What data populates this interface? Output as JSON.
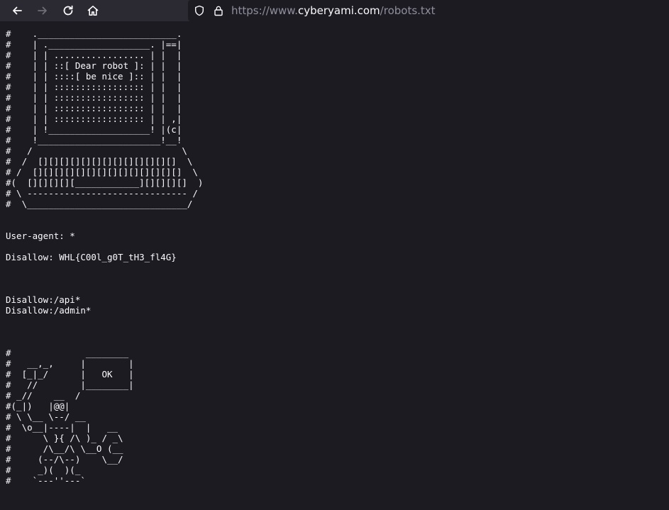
{
  "browser": {
    "url_scheme": "https://www.",
    "url_host": "cyberyami.com",
    "url_path": "/robots.txt",
    "icons": [
      "back-arrow-icon",
      "forward-arrow-icon",
      "reload-icon",
      "home-icon",
      "shield-icon",
      "lock-icon"
    ],
    "colors": {
      "toolbar": "#2b2a33",
      "page": "#1c1b22",
      "text": "#fbfbfe",
      "url_dim": "#8f8f9d"
    }
  },
  "robots_txt": "#    .__________________________.\n#    | .___________________. |==|\n#    | | ................. | |  |\n#    | | ::[ Dear robot ]: | |  |\n#    | | ::::[ be nice ]:: | |  |\n#    | | ::::::::::::::::: | |  |\n#    | | ::::::::::::::::: | |  |\n#    | | ::::::::::::::::: | |  |\n#    | | ::::::::::::::::: | | ,|\n#    | !___________________! |(c|\n#    !_______________________!__!\n#   /                            \\\n#  /  [][][][][][][][][][][][][]  \\\n# /  [][][][][][][][][][][][][][]  \\\n#(  [][][][][____________][][][][]  )\n# \\ ------------------------------ /\n#  \\______________________________/\n\n\nUser-agent: *\n\nDisallow: WHL{C00l_g0T_tH3_fl4G}\n\n\n\nDisallow:/api*\nDisallow:/admin*\n\n\n\n#              ________\n#   __,_,     |        |\n#  [_|_/      |   OK   |\n#   //        |________|\n# _//    __  /\n#(_|)   |@@|\n# \\ \\__ \\--/ __\n#  \\o__|----|  |   __\n#      \\ }{ /\\ )_ / _\\\n#      /\\__/\\ \\__O (__\n#     (--/\\--)    \\__/\n#     _)(  )(_\n#    `---''---`"
}
